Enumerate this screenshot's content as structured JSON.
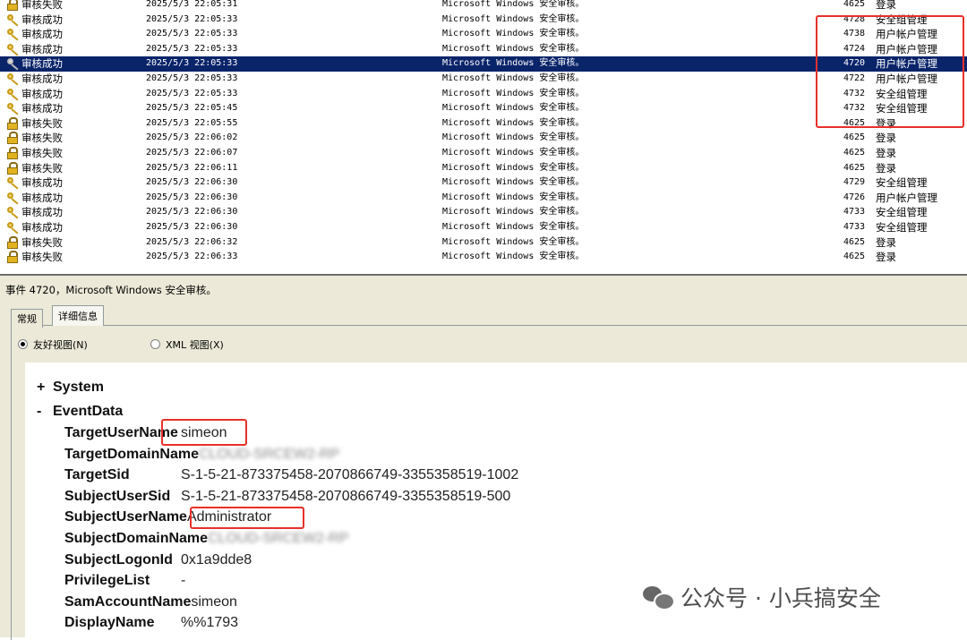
{
  "event_list": {
    "rows": [
      {
        "icon": "lock-icon",
        "level": "审核失败",
        "datetime": "2025/5/3 22:05:31",
        "source": "Microsoft Windows 安全审核。",
        "event_id": "4625",
        "category": "登录"
      },
      {
        "icon": "key-icon",
        "level": "审核成功",
        "datetime": "2025/5/3 22:05:33",
        "source": "Microsoft Windows 安全审核。",
        "event_id": "4728",
        "category": "安全组管理"
      },
      {
        "icon": "key-icon",
        "level": "审核成功",
        "datetime": "2025/5/3 22:05:33",
        "source": "Microsoft Windows 安全审核。",
        "event_id": "4738",
        "category": "用户帐户管理"
      },
      {
        "icon": "key-icon",
        "level": "审核成功",
        "datetime": "2025/5/3 22:05:33",
        "source": "Microsoft Windows 安全审核。",
        "event_id": "4724",
        "category": "用户帐户管理"
      },
      {
        "icon": "key-icon",
        "level": "审核成功",
        "datetime": "2025/5/3 22:05:33",
        "source": "Microsoft Windows 安全审核。",
        "event_id": "4720",
        "category": "用户帐户管理",
        "selected": true
      },
      {
        "icon": "key-icon",
        "level": "审核成功",
        "datetime": "2025/5/3 22:05:33",
        "source": "Microsoft Windows 安全审核。",
        "event_id": "4722",
        "category": "用户帐户管理"
      },
      {
        "icon": "key-icon",
        "level": "审核成功",
        "datetime": "2025/5/3 22:05:33",
        "source": "Microsoft Windows 安全审核。",
        "event_id": "4732",
        "category": "安全组管理"
      },
      {
        "icon": "key-icon",
        "level": "审核成功",
        "datetime": "2025/5/3 22:05:45",
        "source": "Microsoft Windows 安全审核。",
        "event_id": "4732",
        "category": "安全组管理"
      },
      {
        "icon": "lock-icon",
        "level": "审核失败",
        "datetime": "2025/5/3 22:05:55",
        "source": "Microsoft Windows 安全审核。",
        "event_id": "4625",
        "category": "登录"
      },
      {
        "icon": "lock-icon",
        "level": "审核失败",
        "datetime": "2025/5/3 22:06:02",
        "source": "Microsoft Windows 安全审核。",
        "event_id": "4625",
        "category": "登录"
      },
      {
        "icon": "lock-icon",
        "level": "审核失败",
        "datetime": "2025/5/3 22:06:07",
        "source": "Microsoft Windows 安全审核。",
        "event_id": "4625",
        "category": "登录"
      },
      {
        "icon": "lock-icon",
        "level": "审核失败",
        "datetime": "2025/5/3 22:06:11",
        "source": "Microsoft Windows 安全审核。",
        "event_id": "4625",
        "category": "登录"
      },
      {
        "icon": "key-icon",
        "level": "审核成功",
        "datetime": "2025/5/3 22:06:30",
        "source": "Microsoft Windows 安全审核。",
        "event_id": "4729",
        "category": "安全组管理"
      },
      {
        "icon": "key-icon",
        "level": "审核成功",
        "datetime": "2025/5/3 22:06:30",
        "source": "Microsoft Windows 安全审核。",
        "event_id": "4726",
        "category": "用户帐户管理"
      },
      {
        "icon": "key-icon",
        "level": "审核成功",
        "datetime": "2025/5/3 22:06:30",
        "source": "Microsoft Windows 安全审核。",
        "event_id": "4733",
        "category": "安全组管理"
      },
      {
        "icon": "key-icon",
        "level": "审核成功",
        "datetime": "2025/5/3 22:06:30",
        "source": "Microsoft Windows 安全审核。",
        "event_id": "4733",
        "category": "安全组管理"
      },
      {
        "icon": "lock-icon",
        "level": "审核失败",
        "datetime": "2025/5/3 22:06:32",
        "source": "Microsoft Windows 安全审核。",
        "event_id": "4625",
        "category": "登录"
      },
      {
        "icon": "lock-icon",
        "level": "审核失败",
        "datetime": "2025/5/3 22:06:33",
        "source": "Microsoft Windows 安全审核。",
        "event_id": "4625",
        "category": "登录"
      }
    ]
  },
  "detail": {
    "title": "事件 4720，Microsoft Windows 安全审核。",
    "tabs": {
      "general": "常规",
      "details": "详细信息"
    },
    "views": {
      "friendly": "友好视图(N)",
      "xml": "XML 视图(X)"
    },
    "system_label": "System",
    "eventdata_label": "EventData",
    "fields": [
      {
        "key": "TargetUserName",
        "value": "simeon"
      },
      {
        "key": "TargetDomainName",
        "value": "CLOUD-SRCEW2-RP",
        "obscured": true
      },
      {
        "key": "TargetSid",
        "value": "S-1-5-21-873375458-2070866749-3355358519-1002"
      },
      {
        "key": "SubjectUserSid",
        "value": "S-1-5-21-873375458-2070866749-3355358519-500"
      },
      {
        "key": "SubjectUserName",
        "value": "Administrator"
      },
      {
        "key": "SubjectDomainName",
        "value": "CLOUD-SRCEW2-RP",
        "obscured": true
      },
      {
        "key": "SubjectLogonId",
        "value": "0x1a9dde8"
      },
      {
        "key": "PrivilegeList",
        "value": "-"
      },
      {
        "key": "SamAccountName",
        "value": "simeon"
      },
      {
        "key": "DisplayName",
        "value": "%%1793"
      }
    ]
  },
  "watermark": {
    "text": "公众号 · 小兵搞安全"
  },
  "colors": {
    "selection": "#0a246a",
    "highlight_box": "#e8302a",
    "panel_bg": "#ece9d8"
  }
}
